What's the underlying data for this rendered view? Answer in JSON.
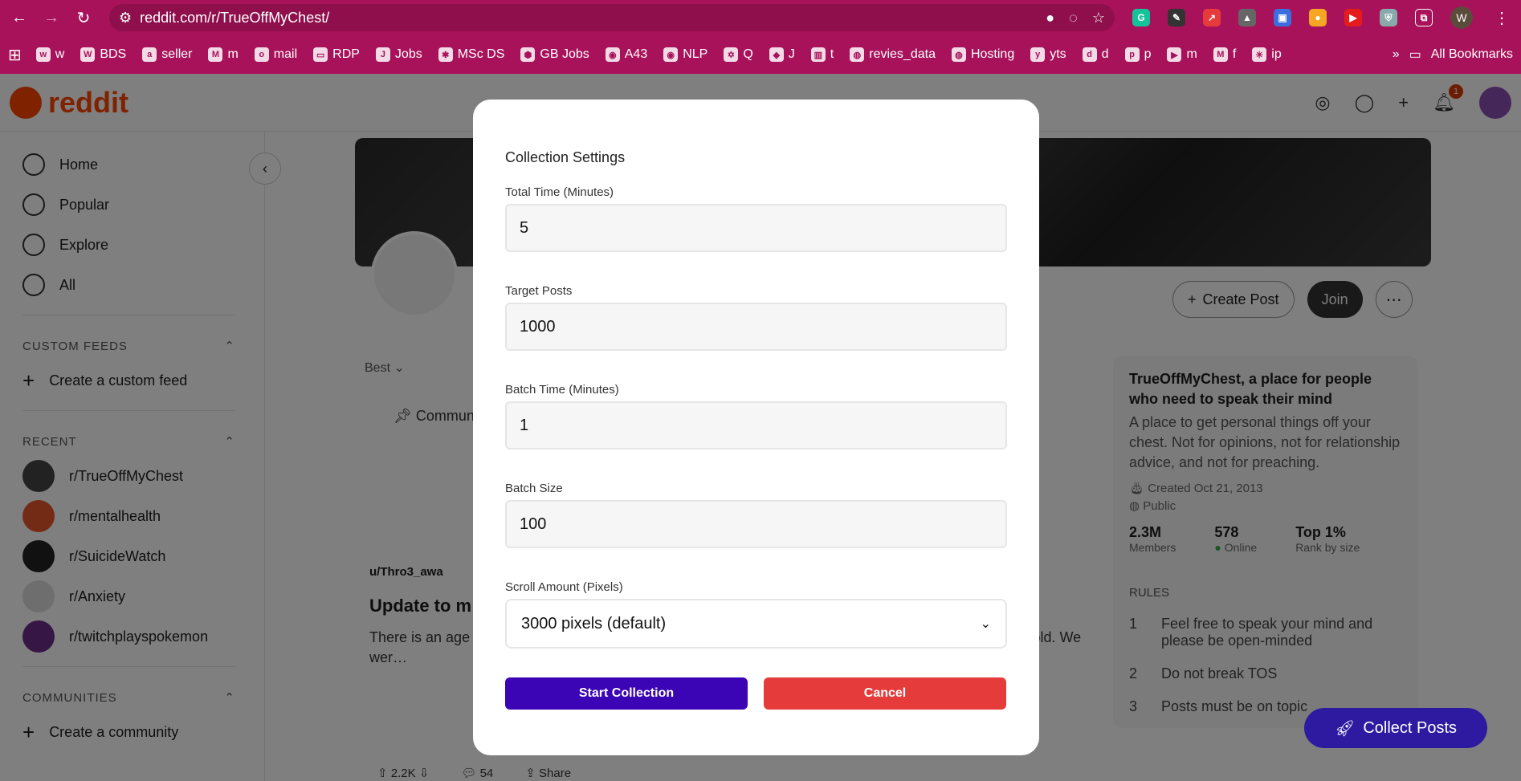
{
  "browser": {
    "url": "reddit.com/r/TrueOffMyChest/",
    "profile_initial": "W",
    "bookmarks": [
      "w",
      "BDS",
      "seller",
      "m",
      "mail",
      "RDP",
      "Jobs",
      "MSc DS",
      "GB Jobs",
      "A43",
      "NLP",
      "Q",
      "J",
      "t",
      "revies_data",
      "Hosting",
      "yts",
      "d",
      "p",
      "m",
      "f",
      "ip"
    ],
    "all_bookmarks": "All Bookmarks"
  },
  "reddit": {
    "logo_text": "reddit",
    "notification_count": "1",
    "nav": [
      "Home",
      "Popular",
      "Explore",
      "All"
    ],
    "custom_feeds_heading": "CUSTOM FEEDS",
    "create_custom_feed": "Create a custom feed",
    "recent_heading": "RECENT",
    "recent": [
      "r/TrueOffMyChest",
      "r/mentalhealth",
      "r/SuicideWatch",
      "r/Anxiety",
      "r/twitchplayspokemon"
    ],
    "communities_heading": "COMMUNITIES",
    "create_community": "Create a community",
    "create_post": "Create Post",
    "join": "Join",
    "sort": "Best",
    "community_highlights": "Community h",
    "post_user": "u/Thro3_awa",
    "post_title": "Update to m",
    "post_text": "There is an age d… 9 years younger… difference, I'm N… of the comments… My ex-husband h… year old. We wer…",
    "upvotes": "2.2K",
    "comments": "54",
    "share": "Share",
    "about_title": "TrueOffMyChest, a place for people who need to speak their mind",
    "about_desc": "A place to get personal things off your chest. Not for opinions, not for relationship advice, and not for preaching.",
    "created": "Created Oct 21, 2013",
    "visibility": "Public",
    "stats": [
      {
        "value": "2.3M",
        "label": "Members"
      },
      {
        "value": "578",
        "label": "Online"
      },
      {
        "value": "Top 1%",
        "label": "Rank by size"
      }
    ],
    "rules_heading": "RULES",
    "rules": [
      "Feel free to speak your mind and please be open-minded",
      "Do not break TOS",
      "Posts must be on topic"
    ],
    "collect_posts": "Collect Posts"
  },
  "modal": {
    "title": "Collection Settings",
    "fields": [
      {
        "label": "Total Time (Minutes)",
        "value": "5"
      },
      {
        "label": "Target Posts",
        "value": "1000"
      },
      {
        "label": "Batch Time (Minutes)",
        "value": "1"
      },
      {
        "label": "Batch Size",
        "value": "100"
      }
    ],
    "scroll_label": "Scroll Amount (Pixels)",
    "scroll_value": "3000 pixels (default)",
    "start_label": "Start Collection",
    "cancel_label": "Cancel"
  },
  "colors": {
    "browser_chrome": "#a8125a",
    "start_button": "#3b04b5",
    "cancel_button": "#e63b3b",
    "collect_posts": "#2d1aa0"
  }
}
